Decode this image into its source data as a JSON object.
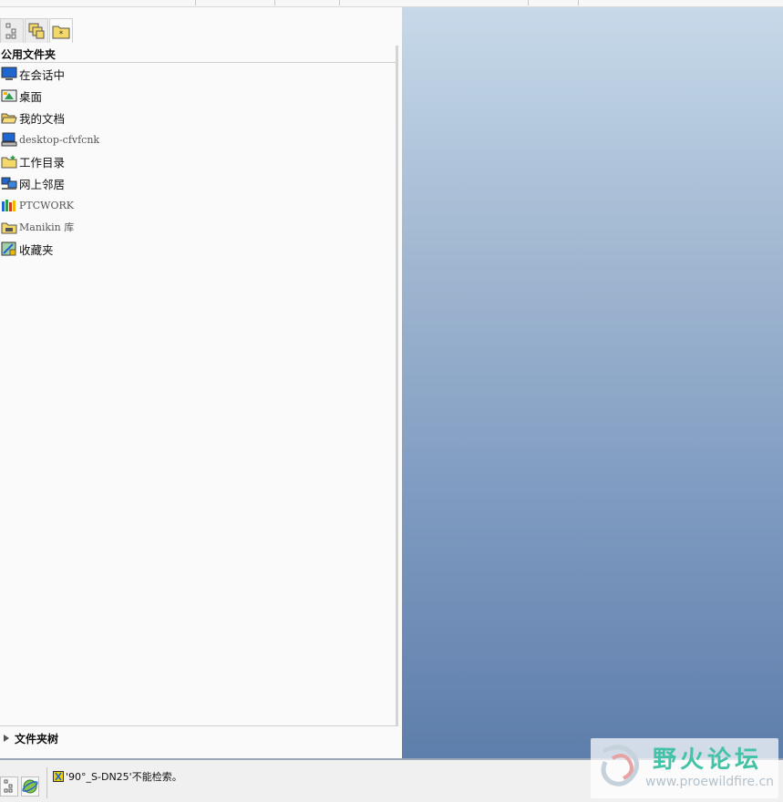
{
  "panel": {
    "title": "公用文件夹",
    "items": [
      {
        "label": "在会话中",
        "icon": "monitor-icon"
      },
      {
        "label": "桌面",
        "icon": "desktop-icon"
      },
      {
        "label": "我的文档",
        "icon": "open-folder-icon"
      },
      {
        "label": "desktop-cfvfcnk",
        "icon": "computer-icon"
      },
      {
        "label": "工作目录",
        "icon": "working-folder-icon"
      },
      {
        "label": "网上邻居",
        "icon": "network-icon"
      },
      {
        "label": "PTCWORK",
        "icon": "library-icon"
      },
      {
        "label": "Manikin 库",
        "icon": "manikin-folder-icon"
      },
      {
        "label": "收藏夹",
        "icon": "favorites-icon"
      }
    ],
    "footer": "文件夹树"
  },
  "status": {
    "message": "'90°_S-DN25'不能检索。"
  },
  "watermark": {
    "title": "野火论坛",
    "url": "www.proewildfire.cn"
  },
  "colors": {
    "graphics_top": "#c7d9e9",
    "graphics_bottom": "#5e7eab",
    "watermark_green": "#44c2a6"
  }
}
